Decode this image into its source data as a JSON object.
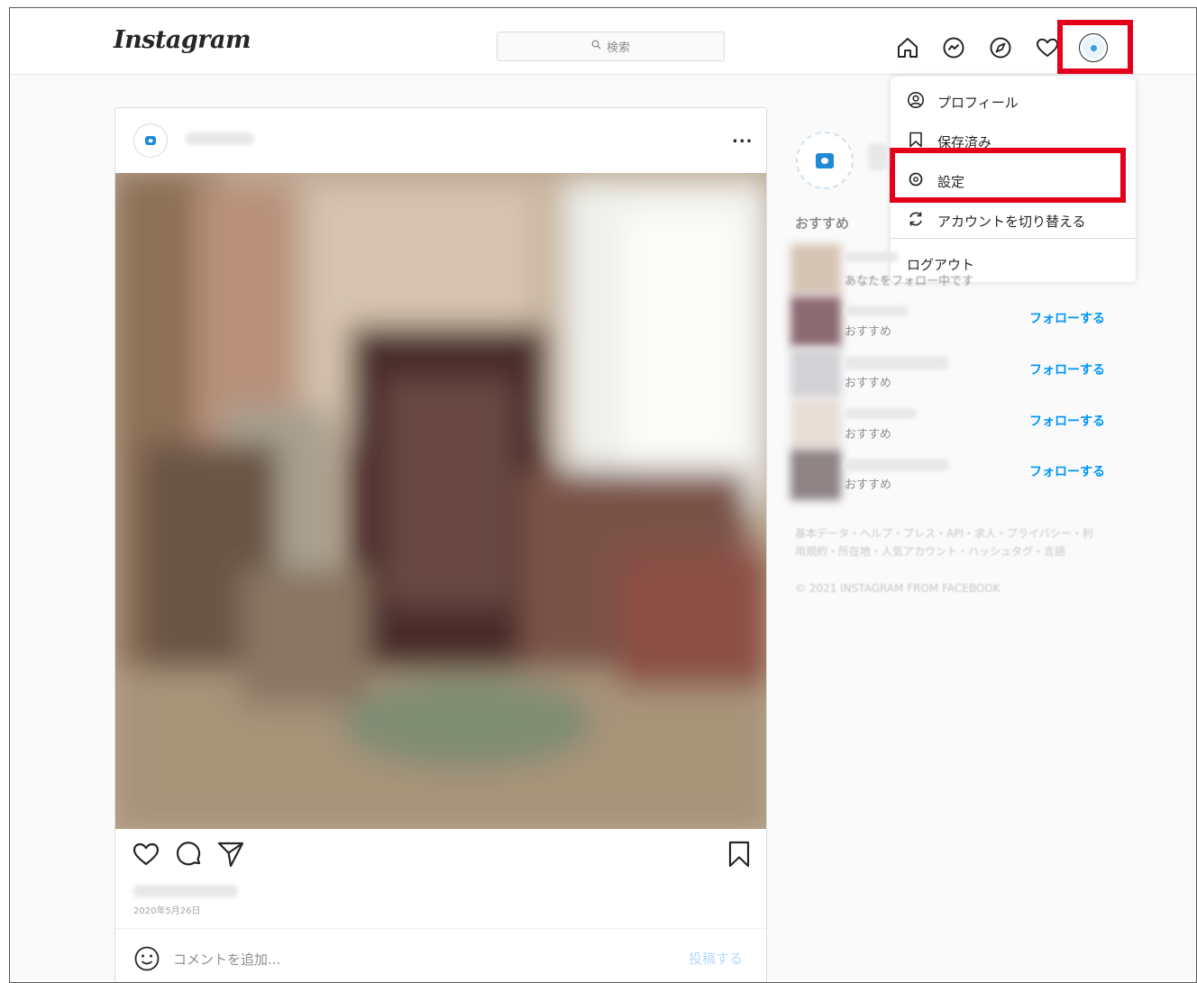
{
  "header": {
    "logo": "Instagram",
    "search_placeholder": "検索",
    "nav_icons": [
      "home-icon",
      "messenger-icon",
      "explore-icon",
      "heart-icon",
      "profile-avatar"
    ]
  },
  "dropdown": {
    "items": [
      {
        "label": "プロフィール",
        "icon": "profile-circle-icon"
      },
      {
        "label": "保存済み",
        "icon": "bookmark-icon"
      },
      {
        "label": "設定",
        "icon": "gear-icon"
      },
      {
        "label": "アカウントを切り替える",
        "icon": "switch-account-icon"
      }
    ],
    "logout_label": "ログアウト"
  },
  "post": {
    "more_label": "...",
    "date": "2020年5月26日",
    "comment_placeholder": "コメントを追加...",
    "submit_label": "投稿する"
  },
  "sidebar": {
    "recommended_title": "おすすめ",
    "suggestions": [
      {
        "subtitle": "あなたをフォロー中です",
        "follow_label": ""
      },
      {
        "subtitle": "おすすめ",
        "follow_label": "フォローする"
      },
      {
        "subtitle": "おすすめ",
        "follow_label": "フォローする"
      },
      {
        "subtitle": "おすすめ",
        "follow_label": "フォローする"
      },
      {
        "subtitle": "おすすめ",
        "follow_label": "フォローする"
      }
    ],
    "footer_links": "基本データ・ヘルプ・プレス・API・求人・プライバシー・利用規約・所在地・人気アカウント・ハッシュタグ・言語",
    "copyright": "© 2021 INSTAGRAM FROM FACEBOOK"
  },
  "colors": {
    "highlight": "#e4001b",
    "link_blue": "#0095f6",
    "brand_blue": "#1f8ad6"
  }
}
